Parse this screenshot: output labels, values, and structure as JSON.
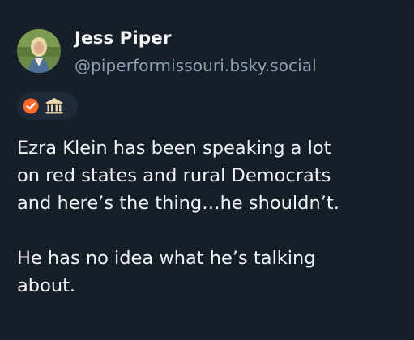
{
  "author": {
    "display_name": "Jess Piper",
    "handle": "@piperformissouri.bsky.social",
    "avatar_icon": "profile-photo",
    "badges": [
      {
        "icon": "verified-check-icon",
        "color": "#ff6a2b"
      },
      {
        "icon": "institution-icon",
        "color": "#e8d8b0"
      }
    ]
  },
  "post": {
    "paragraphs": [
      "Ezra Klein has been speaking a lot\non red states and rural Democrats\nand here’s the thing…he shouldn’t.",
      "He has no idea what he’s talking\nabout."
    ]
  },
  "colors": {
    "background": "#161e27",
    "text_primary": "#f1f3f5",
    "text_secondary": "#8c9eb2",
    "badge_pill": "#1e2a38"
  }
}
